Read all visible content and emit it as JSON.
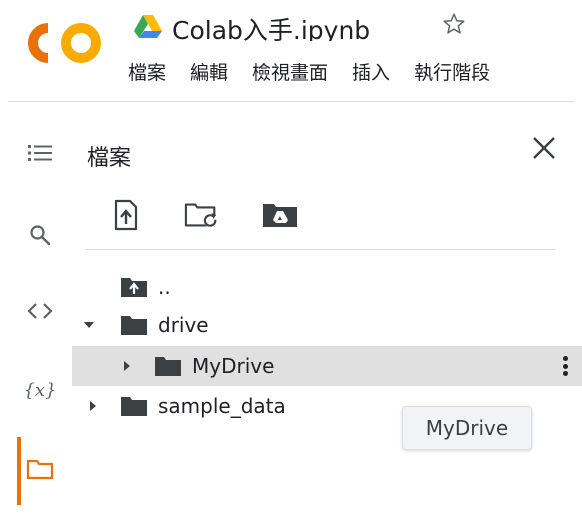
{
  "app": {
    "logo_text": "CO",
    "notebook_title": "Colab入手.ipynb",
    "colors": {
      "logo_orange": "#F9AB00",
      "logo_dark_orange": "#E8710A",
      "active_accent": "#E8710A"
    }
  },
  "menu": {
    "items": [
      {
        "label": "檔案"
      },
      {
        "label": "編輯"
      },
      {
        "label": "檢視畫面"
      },
      {
        "label": "插入"
      },
      {
        "label": "執行階段"
      }
    ]
  },
  "rail": {
    "items": [
      {
        "icon": "toc-icon"
      },
      {
        "icon": "search-icon"
      },
      {
        "icon": "code-snippets-icon"
      },
      {
        "icon": "variables-icon",
        "text": "{x}"
      },
      {
        "icon": "folder-icon",
        "active": true
      }
    ]
  },
  "files_panel": {
    "title": "檔案",
    "toolbar": [
      "upload-file-icon",
      "refresh-folder-icon",
      "mount-drive-icon"
    ],
    "tree": {
      "parent_label": "..",
      "drive_label": "drive",
      "mydrive_label": "MyDrive",
      "sample_label": "sample_data"
    },
    "tooltip": "MyDrive"
  }
}
